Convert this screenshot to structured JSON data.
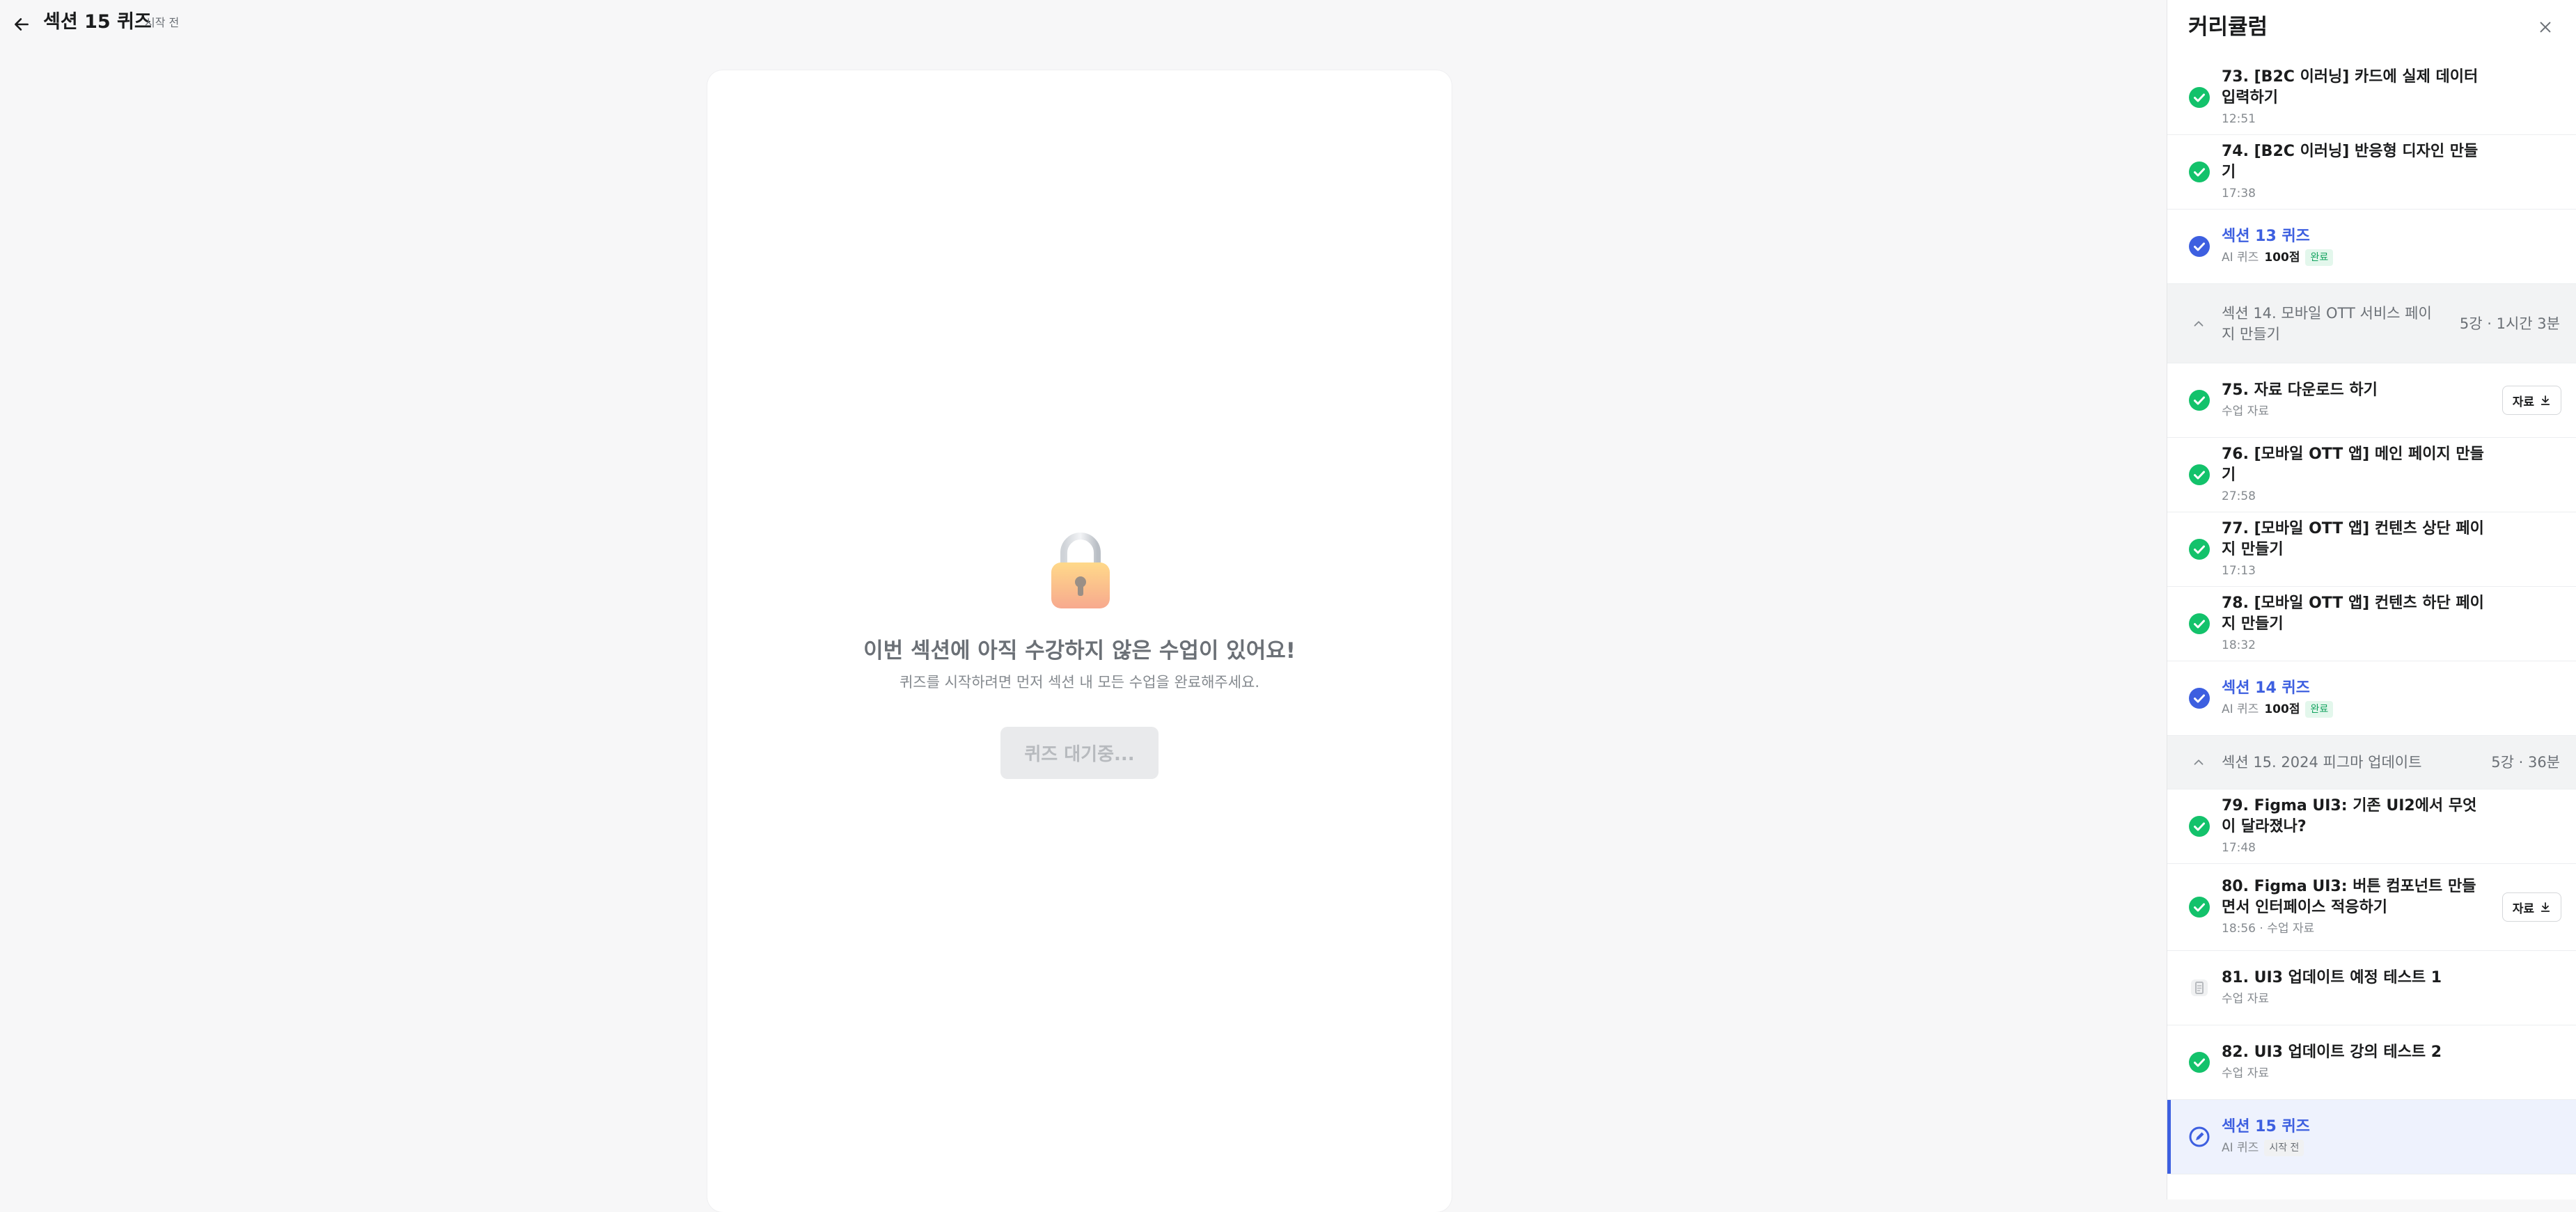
{
  "header": {
    "title": "섹션 15 퀴즈",
    "status": "시작 전"
  },
  "quiz": {
    "locked_title": "이번 섹션에 아직 수강하지 않은 수업이 있어요!",
    "locked_desc": "퀴즈를 시작하려면 먼저 섹션 내 모든 수업을 완료해주세요.",
    "wait_button": "퀴즈 대기중..."
  },
  "curriculum": {
    "title": "커리큘럼",
    "items": [
      {
        "title": "73. [B2C 이러닝] 카드에 실제 데이터 입력하기",
        "sub": "12:51"
      },
      {
        "title": "74. [B2C 이러닝] 반응형 디자인 만들기",
        "sub": "17:38"
      },
      {
        "title": "섹션 13 퀴즈",
        "sub": "AI 퀴즈",
        "score": "100점",
        "badge": "완료"
      },
      {
        "section": "섹션 14. 모바일 OTT 서비스 페이지 만들기",
        "meta": "5강 · 1시간 3분"
      },
      {
        "title": "75. 자료 다운로드 하기",
        "sub": "수업 자료",
        "button": "자료"
      },
      {
        "title": "76. [모바일 OTT 앱] 메인 페이지 만들기",
        "sub": "27:58"
      },
      {
        "title": "77. [모바일 OTT 앱] 컨텐츠 상단 페이지 만들기",
        "sub": "17:13"
      },
      {
        "title": "78. [모바일 OTT 앱] 컨텐츠 하단 페이지 만들기",
        "sub": "18:32"
      },
      {
        "title": "섹션 14 퀴즈",
        "sub": "AI 퀴즈",
        "score": "100점",
        "badge": "완료"
      },
      {
        "section": "섹션 15. 2024 피그마 업데이트",
        "meta": "5강 · 36분"
      },
      {
        "title": "79. Figma UI3: 기존 UI2에서 무엇이 달라졌나?",
        "sub": "17:48"
      },
      {
        "title": "80. Figma UI3: 버튼 컴포넌트 만들면서  인터페이스 적응하기",
        "sub": "18:56 · 수업 자료",
        "button": "자료"
      },
      {
        "title": "81. UI3 업데이트 예정 테스트 1",
        "sub": "수업 자료"
      },
      {
        "title": "82. UI3 업데이트 강의 테스트 2",
        "sub": "수업 자료"
      },
      {
        "title": "섹션 15 퀴즈",
        "sub": "AI 퀴즈",
        "badge": "시작 전"
      }
    ]
  },
  "colors": {
    "accent": "#3d5fe0",
    "check_green": "#13c26b",
    "done_badge": "#13a35f"
  },
  "icons": {
    "back": "arrow-left-icon",
    "close": "close-icon",
    "lock": "lock-icon",
    "check": "check-circle-icon",
    "quiz_done": "check-circle-blue-icon",
    "download": "download-icon",
    "document": "document-icon",
    "quiz_active": "quiz-pen-icon",
    "chevron": "chevron-up-icon"
  }
}
